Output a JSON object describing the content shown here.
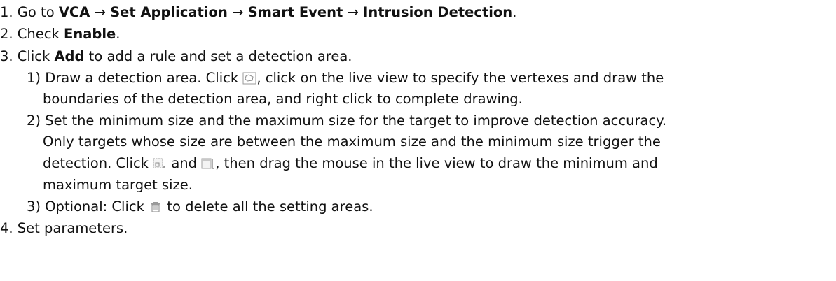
{
  "steps": {
    "s1": {
      "prefix": "1. Go to ",
      "path": [
        "VCA",
        "Set Application",
        "Smart Event",
        "Intrusion Detection"
      ],
      "arrow": "→",
      "suffix": "."
    },
    "s2": {
      "prefix": "2. Check ",
      "bold": "Enable",
      "suffix": "."
    },
    "s3": {
      "prefix": "3. Click ",
      "bold": "Add",
      "suffix": " to add a rule and set a detection area."
    },
    "s3_1": {
      "text_a": "1) Draw a detection area. Click ",
      "text_b": ", click on the live view to specify the vertexes and draw the",
      "line2": "boundaries of the detection area, and right click to complete drawing.",
      "icon": "draw-area-icon"
    },
    "s3_2": {
      "line1": "2) Set the minimum size and the maximum size for the target to improve detection accuracy.",
      "line2": "Only targets whose size are between the maximum size and the minimum size trigger the",
      "text_a": "detection. Click ",
      "text_b": " and ",
      "text_c": ", then drag the mouse in the live view to draw the minimum and",
      "line4": "maximum target size.",
      "icons": [
        "min-size-icon",
        "max-size-icon"
      ]
    },
    "s3_3": {
      "text_a": "3) Optional: Click ",
      "text_b": " to delete all the setting areas.",
      "icon": "delete-icon"
    },
    "s4": {
      "text": "4. Set parameters."
    }
  }
}
